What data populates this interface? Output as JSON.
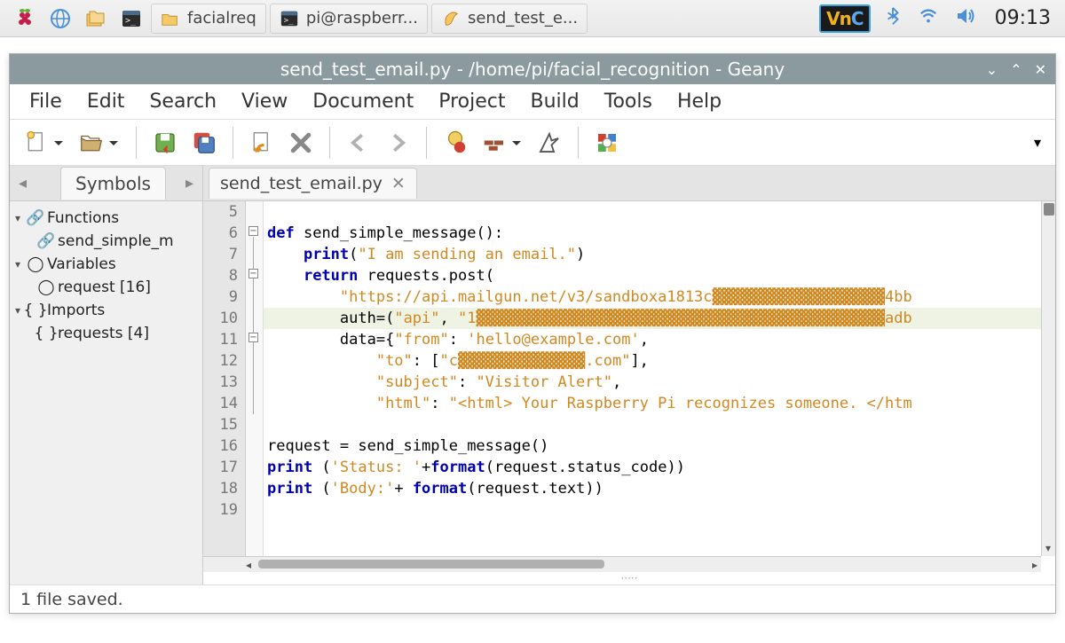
{
  "taskbar": {
    "tasks": [
      {
        "label": "facialreq"
      },
      {
        "label": "pi@raspberr..."
      },
      {
        "label": "send_test_e..."
      }
    ],
    "clock": "09:13",
    "vnc": "VnC"
  },
  "window": {
    "title": "send_test_email.py - /home/pi/facial_recognition - Geany",
    "menu": [
      "File",
      "Edit",
      "Search",
      "View",
      "Document",
      "Project",
      "Build",
      "Tools",
      "Help"
    ]
  },
  "sidebar": {
    "tab": "Symbols",
    "groups": [
      {
        "label": "Functions",
        "icon": "fn",
        "children": [
          {
            "label": "send_simple_m",
            "icon": "fn"
          }
        ]
      },
      {
        "label": "Variables",
        "icon": "var",
        "children": [
          {
            "label": "request [16]",
            "icon": "var"
          }
        ]
      },
      {
        "label": "Imports",
        "icon": "imp",
        "children": [
          {
            "label": "requests [4]",
            "icon": "imp"
          }
        ]
      }
    ]
  },
  "editor": {
    "tab": "send_test_email.py",
    "first_line": 5,
    "lines": [
      "",
      "def send_simple_message():",
      "    print(\"I am sending an email.\")",
      "    return requests.post(",
      "        \"https://api.mailgun.net/v3/sandboxa1813c▓▓▓▓▓▓▓▓▓▓▓▓▓▓▓▓▓▓▓4bb",
      "        auth=(\"api\", \"1▓▓▓▓▓▓▓▓▓▓▓▓▓▓▓▓▓▓▓▓▓▓▓▓▓▓▓▓▓▓▓▓▓▓▓▓▓▓▓▓▓▓▓▓▓adb",
      "        data={\"from\": 'hello@example.com',",
      "            \"to\": [\"c▓▓▓▓▓▓▓▓▓▓▓▓▓▓.com\"],",
      "            \"subject\": \"Visitor Alert\",",
      "            \"html\": \"<html> Your Raspberry Pi recognizes someone. </htm",
      "",
      "request = send_simple_message()",
      "print ('Status: '+format(request.status_code))",
      "print ('Body:'+ format(request.text))",
      ""
    ]
  },
  "status": {
    "message": "1 file saved."
  }
}
